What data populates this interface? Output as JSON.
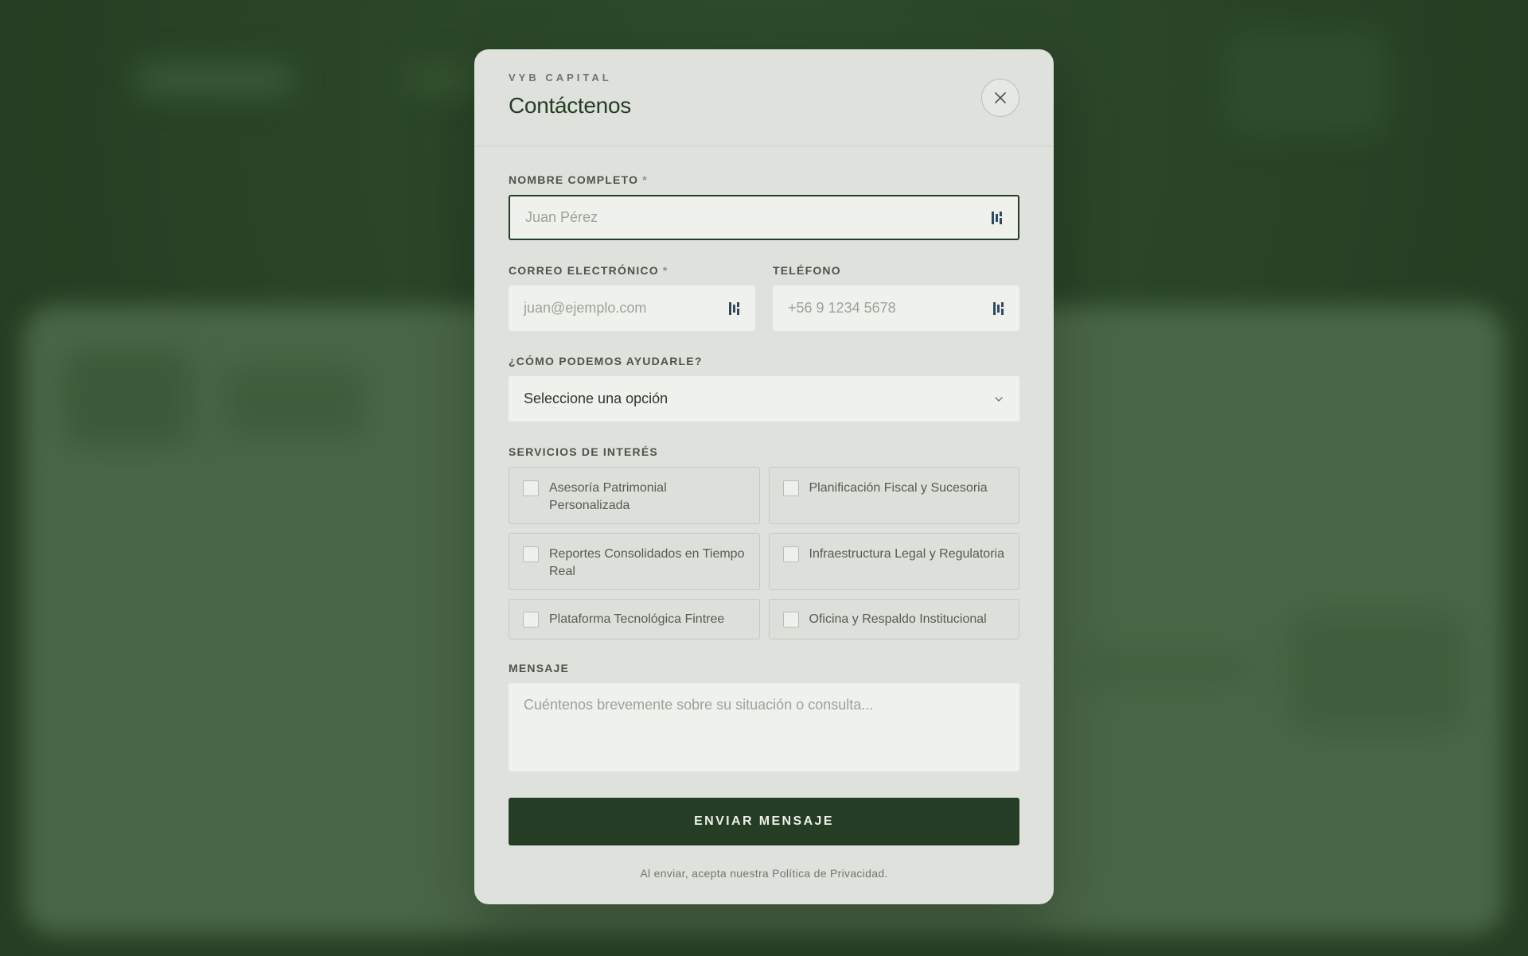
{
  "modal": {
    "eyebrow": "VYB CAPITAL",
    "title": "Contáctenos"
  },
  "form": {
    "name": {
      "label": "NOMBRE COMPLETO",
      "required_mark": "*",
      "placeholder": "Juan Pérez"
    },
    "email": {
      "label": "CORREO ELECTRÓNICO",
      "required_mark": "*",
      "placeholder": "juan@ejemplo.com"
    },
    "phone": {
      "label": "TELÉFONO",
      "placeholder": "+56 9 1234 5678"
    },
    "help": {
      "label": "¿CÓMO PODEMOS AYUDARLE?",
      "selected": "Seleccione una opción"
    },
    "services": {
      "label": "SERVICIOS DE INTERÉS",
      "items": [
        "Asesoría Patrimonial Personalizada",
        "Planificación Fiscal y Sucesoria",
        "Reportes Consolidados en Tiempo Real",
        "Infraestructura Legal y Regulatoria",
        "Plataforma Tecnológica Fintree",
        "Oficina y Respaldo Institucional"
      ]
    },
    "message": {
      "label": "MENSAJE",
      "placeholder": "Cuéntenos brevemente sobre su situación o consulta..."
    },
    "submit_label": "ENVIAR MENSAJE",
    "footnote": "Al enviar, acepta nuestra Política de Privacidad."
  },
  "icons": {
    "close": "close-icon",
    "password_manager": "password-manager-icon",
    "chevron": "chevron-down-icon"
  },
  "colors": {
    "brand_dark_green": "#243d24",
    "modal_bg": "#dfe2dc",
    "field_bg": "#eff1ed",
    "backdrop": "#2a4528"
  }
}
